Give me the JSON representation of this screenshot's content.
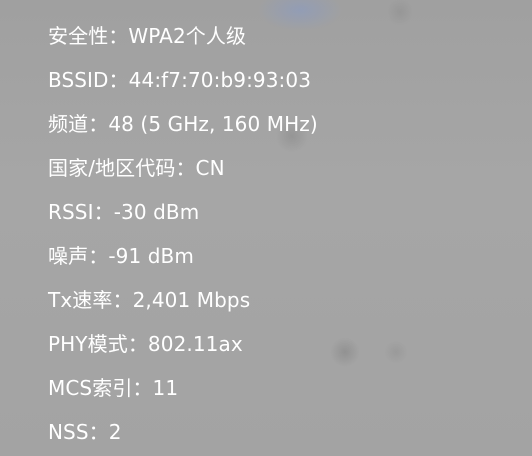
{
  "wifi_details": {
    "rows": [
      {
        "label": "安全性：",
        "value": "WPA2个人级"
      },
      {
        "label": "BSSID：",
        "value": "44:f7:70:b9:93:03"
      },
      {
        "label": "频道：",
        "value": "48 (5 GHz, 160 MHz)"
      },
      {
        "label": "国家/地区代码：",
        "value": "CN"
      },
      {
        "label": "RSSI：",
        "value": "-30 dBm"
      },
      {
        "label": "噪声：",
        "value": "-91 dBm"
      },
      {
        "label": "Tx速率：",
        "value": "2,401 Mbps"
      },
      {
        "label": "PHY模式：",
        "value": "802.11ax"
      },
      {
        "label": "MCS索引：",
        "value": "11"
      },
      {
        "label": "NSS：",
        "value": "2"
      }
    ]
  }
}
